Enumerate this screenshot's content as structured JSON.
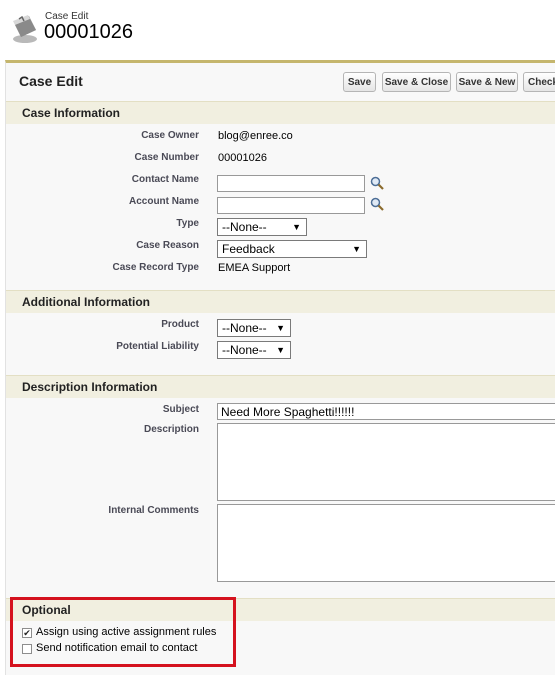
{
  "header": {
    "subtitle": "Case Edit",
    "title": "00001026"
  },
  "panel": {
    "title": "Case Edit",
    "buttons": {
      "save": "Save",
      "save_close": "Save & Close",
      "save_new": "Save & New",
      "check": "Check"
    }
  },
  "sections": {
    "case_information": {
      "title": "Case Information",
      "case_owner_label": "Case Owner",
      "case_owner": "blog@enree.co",
      "case_number_label": "Case Number",
      "case_number": "00001026",
      "contact_name_label": "Contact Name",
      "contact_name": "",
      "account_name_label": "Account Name",
      "account_name": "",
      "type_label": "Type",
      "type_value": "--None--",
      "case_reason_label": "Case Reason",
      "case_reason_value": "Feedback",
      "record_type_label": "Case Record Type",
      "record_type": "EMEA Support"
    },
    "additional_information": {
      "title": "Additional Information",
      "product_label": "Product",
      "product_value": "--None--",
      "liability_label": "Potential Liability",
      "liability_value": "--None--"
    },
    "description_information": {
      "title": "Description Information",
      "subject_label": "Subject",
      "subject_value": "Need More Spaghetti!!!!!!",
      "description_label": "Description",
      "description_value": "",
      "internal_comments_label": "Internal Comments",
      "internal_comments_value": ""
    },
    "optional": {
      "title": "Optional",
      "assign_label": "Assign using active assignment rules",
      "assign_checked": true,
      "notify_label": "Send notification email to contact",
      "notify_checked": false
    }
  },
  "icons": {
    "case": "case-briefcase-icon",
    "lookup": "magnifier-lookup-icon"
  },
  "colors": {
    "panel_border": "#c5b66d",
    "section_bg": "#f1efe0",
    "highlight": "#d5121e"
  }
}
